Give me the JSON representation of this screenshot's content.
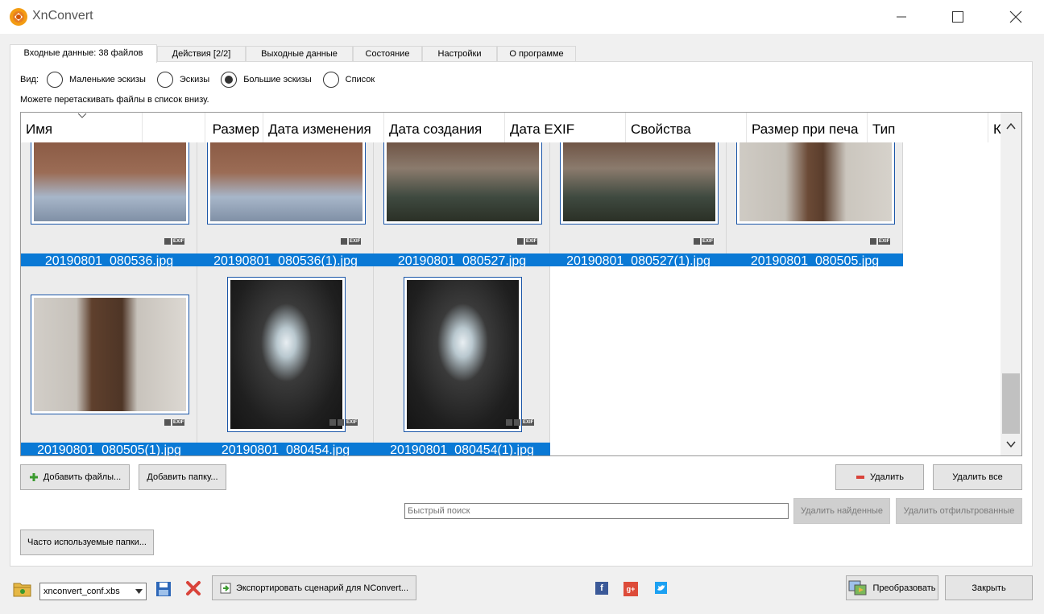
{
  "window": {
    "title": "XnConvert",
    "minimize_icon": "minimize-icon",
    "maximize_icon": "maximize-icon",
    "close_icon": "close-icon"
  },
  "tabs": [
    {
      "label": "Входные данные: 38 файлов",
      "active": true
    },
    {
      "label": "Действия [2/2]"
    },
    {
      "label": "Выходные данные"
    },
    {
      "label": "Состояние"
    },
    {
      "label": "Настройки"
    },
    {
      "label": "О программе"
    }
  ],
  "view": {
    "label": "Вид:",
    "options": [
      {
        "label": "Маленькие эскизы",
        "selected": false
      },
      {
        "label": "Эскизы",
        "selected": false
      },
      {
        "label": "Большие эскизы",
        "selected": true
      },
      {
        "label": "Список",
        "selected": false
      }
    ]
  },
  "hint": "Можете перетаскивать файлы в список внизу.",
  "columns": [
    "Имя",
    "",
    "Размер",
    "Дата изменения",
    "Дата создания",
    "Дата EXIF",
    "Свойства",
    "Размер при печа",
    "Тип",
    "К"
  ],
  "files": [
    {
      "name": "20190801_080536.jpg"
    },
    {
      "name": "20190801_080536(1).jpg"
    },
    {
      "name": "20190801_080527.jpg"
    },
    {
      "name": "20190801_080527(1).jpg"
    },
    {
      "name": "20190801_080505.jpg"
    },
    {
      "name": "20190801_080505(1).jpg"
    },
    {
      "name": "20190801_080454.jpg"
    },
    {
      "name": "20190801_080454(1).jpg"
    }
  ],
  "badge_exif": "EXIF",
  "buttons": {
    "add_files": "Добавить файлы...",
    "add_folder": "Добавить папку...",
    "remove": "Удалить",
    "remove_all": "Удалить все",
    "remove_found": "Удалить найденные",
    "remove_filtered": "Удалить отфильтрованные",
    "frequent_folders": "Часто используемые папки...",
    "export_script": "Экспортировать сценарий для NConvert...",
    "convert": "Преобразовать",
    "close": "Закрыть"
  },
  "search": {
    "placeholder": "Быстрый поиск"
  },
  "preset": {
    "value": "xnconvert_conf.xbs"
  },
  "colors": {
    "accent": "#0a79d5",
    "facebook": "#3b5998",
    "googleplus": "#dd4b39",
    "twitter": "#1da1f2"
  }
}
